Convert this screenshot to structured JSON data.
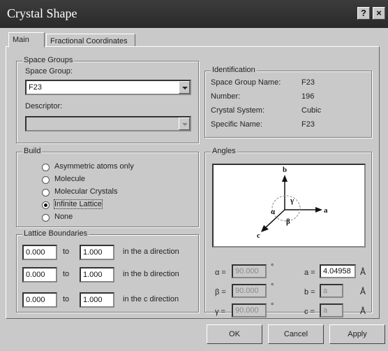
{
  "window": {
    "title": "Crystal Shape",
    "help_btn": "?",
    "close_btn": "×"
  },
  "tabs": [
    {
      "label": "Main"
    },
    {
      "label": "Fractional Coordinates"
    }
  ],
  "space_groups": {
    "group_title": "Space Groups",
    "space_group_label": "Space Group:",
    "space_group_value": "F23",
    "descriptor_label": "Descriptor:",
    "descriptor_value": ""
  },
  "identification": {
    "group_title": "Identification",
    "rows": [
      {
        "key": "Space Group Name:",
        "value": "F23"
      },
      {
        "key": "Number:",
        "value": "196"
      },
      {
        "key": "Crystal System:",
        "value": "Cubic"
      },
      {
        "key": "Specific Name:",
        "value": "F23"
      }
    ]
  },
  "build": {
    "group_title": "Build",
    "options": [
      {
        "label": "Asymmetric atoms only",
        "selected": false
      },
      {
        "label": "Molecule",
        "selected": false
      },
      {
        "label": "Molecular Crystals",
        "selected": false
      },
      {
        "label": "Infinite Lattice",
        "selected": true
      },
      {
        "label": "None",
        "selected": false
      }
    ]
  },
  "lattice": {
    "group_title": "Lattice Boundaries",
    "to_label": "to",
    "rows": [
      {
        "from": "0.000",
        "to": "1.000",
        "direction": "in the a direction"
      },
      {
        "from": "0.000",
        "to": "1.000",
        "direction": "in the b direction"
      },
      {
        "from": "0.000",
        "to": "1.000",
        "direction": "in the c direction"
      }
    ]
  },
  "angles": {
    "group_title": "Angles",
    "axis_labels": {
      "a": "a",
      "b": "b",
      "c": "c",
      "alpha": "α",
      "beta": "β",
      "gamma": "γ"
    },
    "angle_rows": [
      {
        "label": "α =",
        "value": "90.000",
        "unit": "°"
      },
      {
        "label": "β =",
        "value": "90.000",
        "unit": "°"
      },
      {
        "label": "γ =",
        "value": "90.000",
        "unit": "°"
      }
    ],
    "length_rows": [
      {
        "label": "a =",
        "value": "4.04958",
        "unit": "Å"
      },
      {
        "label": "b =",
        "value": "a",
        "unit": "Å"
      },
      {
        "label": "c =",
        "value": "a",
        "unit": "Å"
      }
    ]
  },
  "buttons": {
    "ok": "OK",
    "cancel": "Cancel",
    "apply": "Apply"
  }
}
